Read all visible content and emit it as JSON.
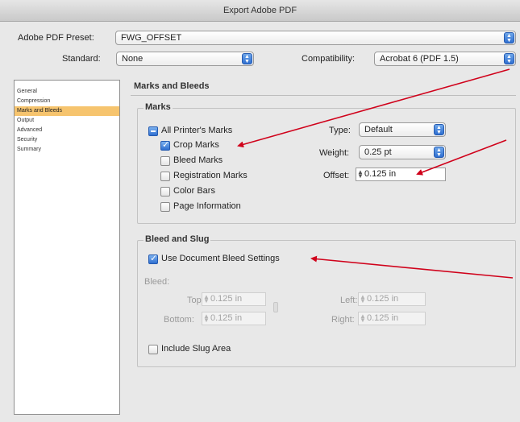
{
  "window": {
    "title": "Export Adobe PDF"
  },
  "header": {
    "preset_label": "Adobe PDF Preset:",
    "preset_value": "FWG_OFFSET",
    "standard_label": "Standard:",
    "standard_value": "None",
    "compat_label": "Compatibility:",
    "compat_value": "Acrobat 6 (PDF 1.5)"
  },
  "sidebar": {
    "items": [
      {
        "label": "General"
      },
      {
        "label": "Compression"
      },
      {
        "label": "Marks and Bleeds"
      },
      {
        "label": "Output"
      },
      {
        "label": "Advanced"
      },
      {
        "label": "Security"
      },
      {
        "label": "Summary"
      }
    ]
  },
  "panel": {
    "title": "Marks and Bleeds"
  },
  "marks": {
    "group_title": "Marks",
    "all_printers": "All Printer's Marks",
    "crop": "Crop Marks",
    "bleed_marks": "Bleed Marks",
    "registration": "Registration Marks",
    "color_bars": "Color Bars",
    "page_info": "Page Information",
    "type_label": "Type:",
    "type_value": "Default",
    "weight_label": "Weight:",
    "weight_value": "0.25 pt",
    "offset_label": "Offset:",
    "offset_value": "0.125 in"
  },
  "bleed": {
    "group_title": "Bleed and Slug",
    "use_doc": "Use Document Bleed Settings",
    "bleed_label": "Bleed:",
    "top_label": "Top:",
    "top_value": "0.125 in",
    "bottom_label": "Bottom:",
    "bottom_value": "0.125 in",
    "left_label": "Left:",
    "left_value": "0.125 in",
    "right_label": "Right:",
    "right_value": "0.125 in",
    "slug": "Include Slug Area"
  },
  "colors": {
    "accent": "#2f6fd0",
    "selection": "#f6c46e",
    "annotation": "#d0021b"
  }
}
